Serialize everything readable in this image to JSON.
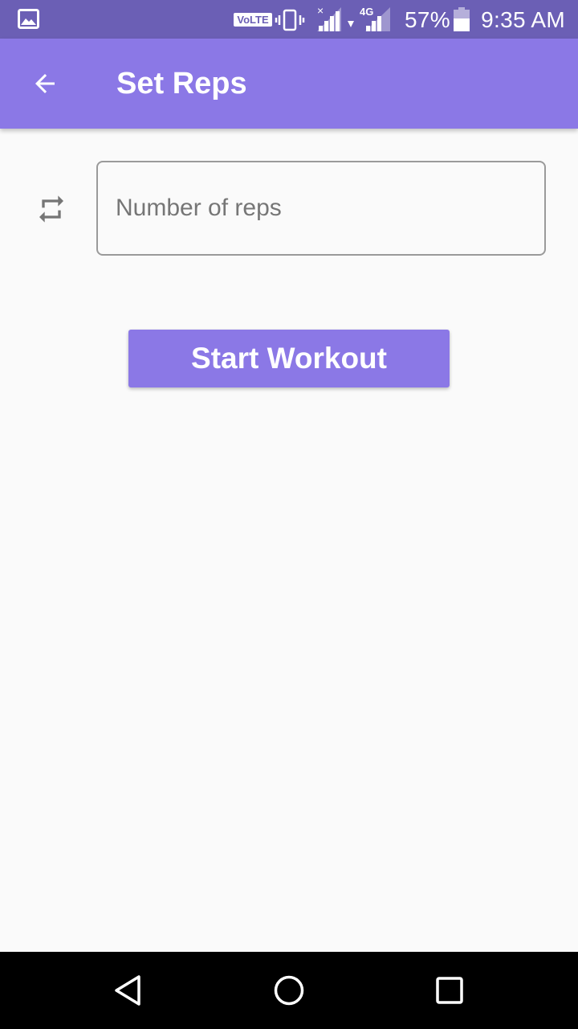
{
  "status_bar": {
    "network_badge": "VoLTE",
    "network_type": "4G",
    "battery_percent": "57%",
    "time": "9:35 AM",
    "icons": [
      "gallery-icon",
      "vibrate-icon",
      "signal-icon",
      "data-arrow-icon",
      "battery-icon"
    ]
  },
  "app_bar": {
    "title": "Set Reps",
    "back_icon": "arrow-back-icon"
  },
  "reps_input": {
    "icon": "repeat-icon",
    "placeholder": "Number of reps",
    "value": ""
  },
  "start_button": {
    "label": "Start Workout"
  },
  "nav_bar": {
    "icons": [
      "nav-back-icon",
      "nav-home-icon",
      "nav-recents-icon"
    ]
  },
  "colors": {
    "status_bar": "#6b5fb5",
    "app_bar": "#8b78e6",
    "button": "#8b78e6",
    "background": "#fafafa",
    "nav_bar": "#000000"
  }
}
